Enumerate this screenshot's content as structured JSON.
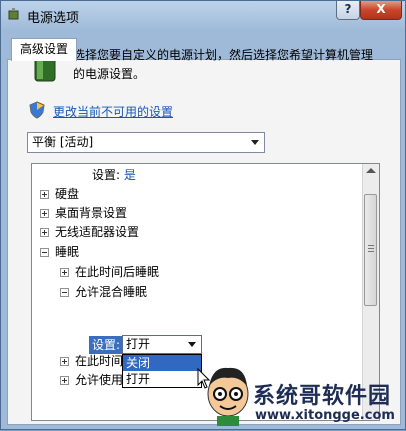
{
  "window": {
    "title": "电源选项",
    "help_label": "?",
    "close_label": "X"
  },
  "tab": {
    "label": "高级设置"
  },
  "intro": "选择您要自定义的电源计划，然后选择您希望计算机管理的电源设置。",
  "change_link": "更改当前不可用的设置",
  "plan_select": {
    "value": "平衡 [活动]"
  },
  "tree": {
    "top_setting_label": "设置:",
    "top_setting_value": "是",
    "items": [
      "硬盘",
      "桌面背景设置",
      "无线适配器设置",
      "睡眠"
    ],
    "sleep_children": [
      "在此时间后睡眠",
      "允许混合睡眠"
    ],
    "hybrid_setting_label": "设置:",
    "hybrid_setting_value": "打开",
    "lower_items": [
      "在此时间",
      "允许使用"
    ]
  },
  "dropdown": {
    "options": [
      "关闭",
      "打开"
    ],
    "selected_index": 0
  },
  "watermark": {
    "name": "系统哥软件园",
    "url": "www.xitongge.com"
  },
  "colors": {
    "selection": "#3168c2",
    "link": "#1a56b5"
  }
}
